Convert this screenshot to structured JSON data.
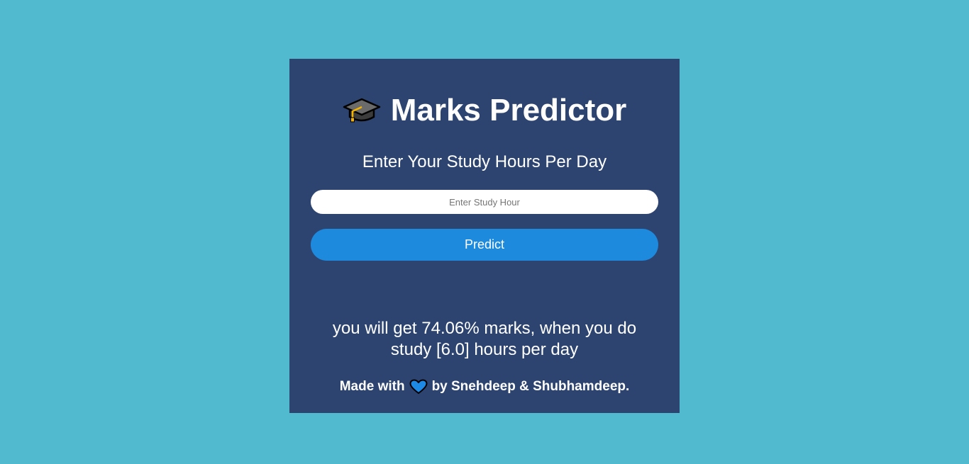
{
  "header": {
    "icon": "graduation-cap-icon",
    "title": "Marks Predictor"
  },
  "form": {
    "prompt": "Enter Your Study Hours Per Day",
    "input_placeholder": "Enter Study Hour",
    "input_value": "",
    "button_label": "Predict"
  },
  "result": {
    "text": "you will get 74.06% marks, when you do study [6.0] hours per day"
  },
  "footer": {
    "prefix": "Made with",
    "icon": "blue-heart-icon",
    "suffix": "by Snehdeep & Shubhamdeep."
  },
  "colors": {
    "page_background": "#52bacf",
    "card_background": "#2d4471",
    "button_background": "#1d8ade",
    "text": "#ffffff"
  }
}
